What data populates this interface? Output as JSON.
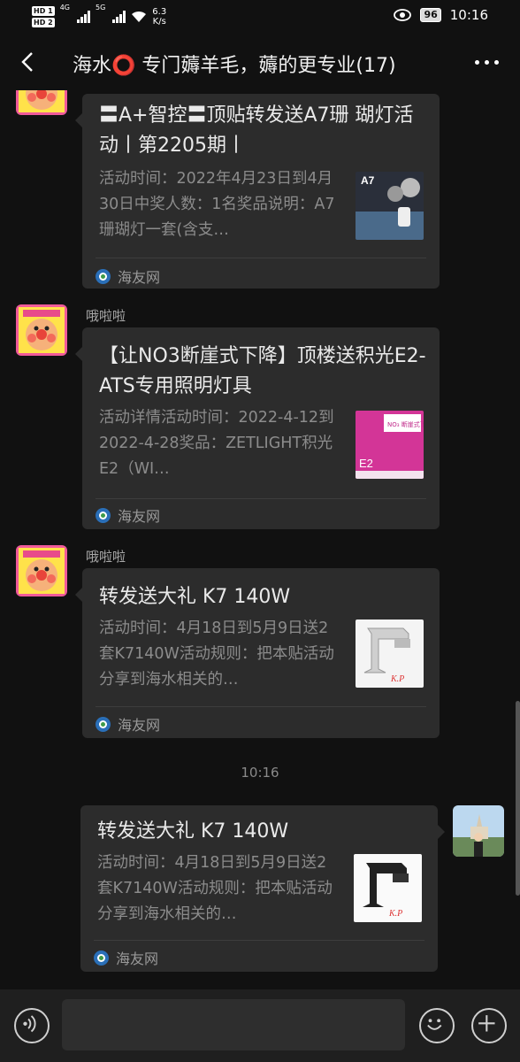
{
  "status": {
    "hd1": "HD 1",
    "hd2": "HD 2",
    "net1": "4G",
    "net2": "5G",
    "speed_value": "6.3",
    "speed_unit": "K/s",
    "battery": "96",
    "clock": "10:16"
  },
  "header": {
    "title": "海水⭕ 专门薅羊毛，薅的更专业(17)",
    "back_icon": "back-arrow-icon",
    "more_icon": "more-dots-icon"
  },
  "messages": [
    {
      "sender": "",
      "title": "〓A+智控〓顶贴转发送A7珊 瑚灯活动丨第2205期丨",
      "desc": "活动时间：2022年4月23日到4月30日中奖人数：1名奖品说明：A7珊瑚灯一套(含支…",
      "source": "海友网"
    },
    {
      "sender": "哦啦啦",
      "title": "【让NO3断崖式下降】顶楼送积光E2-ATS专用照明灯具",
      "desc": "活动详情活动时间：2022-4-12到2022-4-28奖品：ZETLIGHT积光E2（WI…",
      "source": "海友网"
    },
    {
      "sender": "哦啦啦",
      "title": "转发送大礼 K7 140W",
      "desc": "活动时间：4月18日到5月9日送2套K7140W活动规则：把本贴活动分享到海水相关的…",
      "source": "海友网"
    },
    {
      "sender": "",
      "title": "转发送大礼 K7 140W",
      "desc": "活动时间：4月18日到5月9日送2套K7140W活动规则：把本贴活动分享到海水相关的…",
      "source": "海友网"
    }
  ],
  "timestamp": "10:16",
  "thumb_labels": {
    "a7": "A7",
    "e2": "E2",
    "e2_banner": "NO₃ 断崖式下降",
    "kp": "K.P"
  },
  "input_bar": {
    "voice_icon": "voice-icon",
    "emoji_icon": "emoji-icon",
    "plus_icon": "plus-icon"
  },
  "colors": {
    "background": "#111111",
    "bubble": "#2c2c2c",
    "muted_text": "#8c8c8c"
  }
}
